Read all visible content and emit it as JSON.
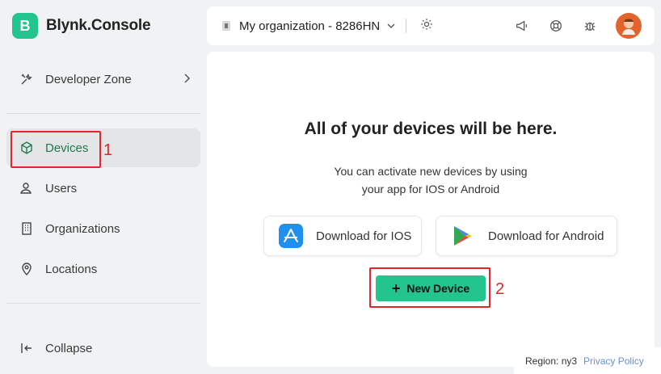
{
  "brand": {
    "logo_letter": "B",
    "name": "Blynk.Console",
    "accent": "#23c48e"
  },
  "sidebar": {
    "developer_zone": "Developer Zone",
    "items": [
      {
        "label": "Devices",
        "icon": "cube-icon",
        "active": true
      },
      {
        "label": "Users",
        "icon": "users-icon",
        "active": false
      },
      {
        "label": "Organizations",
        "icon": "building-icon",
        "active": false
      },
      {
        "label": "Locations",
        "icon": "location-pin-icon",
        "active": false
      }
    ],
    "collapse": "Collapse"
  },
  "topbar": {
    "org_name": "My organization - 8286HN"
  },
  "main": {
    "headline": "All of your devices will be here.",
    "sub_line1": "You can activate new devices by using",
    "sub_line2": "your app for IOS or Android",
    "ios_label": "Download for IOS",
    "android_label": "Download for Android",
    "new_device_label": "New Device"
  },
  "annotations": {
    "one": "1",
    "two": "2",
    "color": "#e0262a"
  },
  "footer": {
    "region": "Region: ny3",
    "privacy": "Privacy Policy"
  }
}
